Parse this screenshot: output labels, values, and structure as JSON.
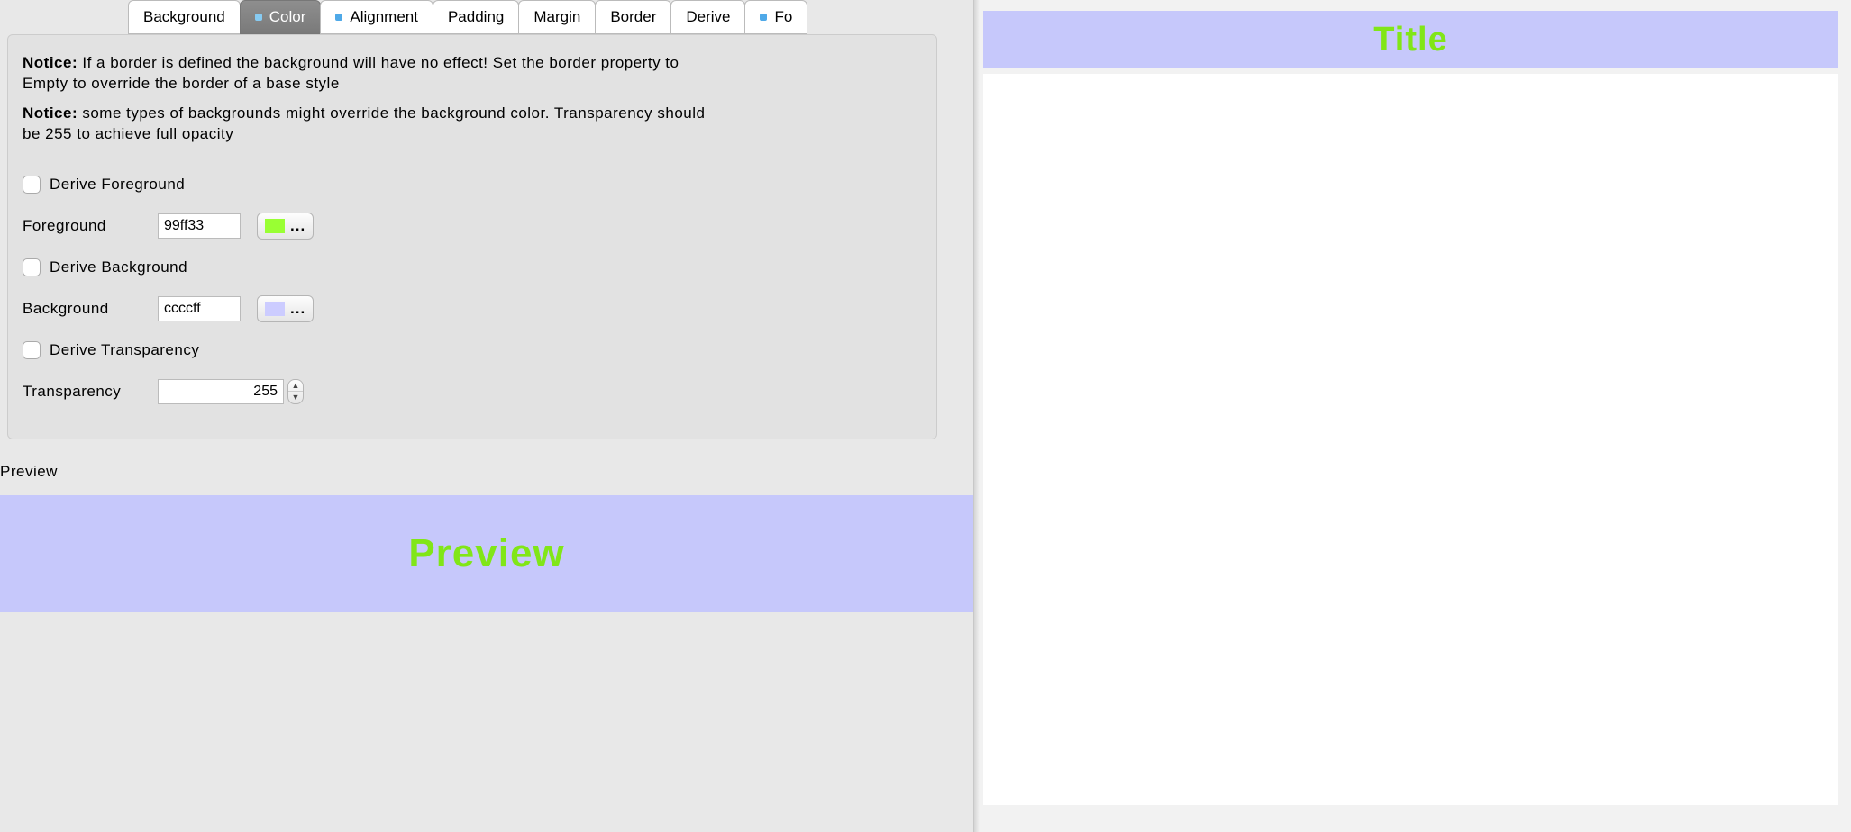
{
  "tabs": [
    {
      "label": "Background",
      "dot": false,
      "selected": false
    },
    {
      "label": "Color",
      "dot": true,
      "selected": true
    },
    {
      "label": "Alignment",
      "dot": true,
      "selected": false
    },
    {
      "label": "Padding",
      "dot": false,
      "selected": false
    },
    {
      "label": "Margin",
      "dot": false,
      "selected": false
    },
    {
      "label": "Border",
      "dot": false,
      "selected": false
    },
    {
      "label": "Derive",
      "dot": false,
      "selected": false
    },
    {
      "label": "Fo",
      "dot": true,
      "selected": false
    }
  ],
  "notices": {
    "n1_prefix": "Notice:",
    "n1_text": " If a border is defined the background will have no effect! Set the border property to Empty to override the border of a base style",
    "n2_prefix": "Notice:",
    "n2_text": " some types of backgrounds might override the background color. Transparency should be 255 to achieve full opacity"
  },
  "controls": {
    "derive_foreground_label": "Derive Foreground",
    "foreground_label": "Foreground",
    "foreground_value": "99ff33",
    "foreground_color": "#99ff33",
    "derive_background_label": "Derive Background",
    "background_label": "Background",
    "background_value": "ccccff",
    "background_color": "#ccccff",
    "derive_transparency_label": "Derive Transparency",
    "transparency_label": "Transparency",
    "transparency_value": "255",
    "ellipsis": "..."
  },
  "preview": {
    "label": "Preview",
    "text": "Preview",
    "fg": "#81e617",
    "bg": "#c6c8fb"
  },
  "right": {
    "title_text": "Title",
    "title_fg": "#81e617",
    "title_bg": "#c6c8fb"
  }
}
